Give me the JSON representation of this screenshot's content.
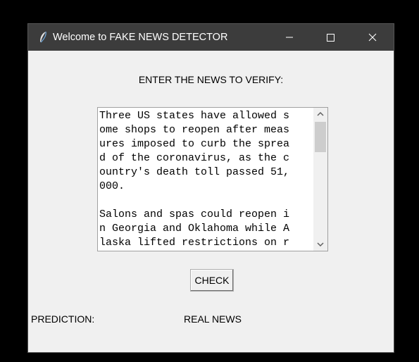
{
  "window": {
    "title": "Welcome to FAKE NEWS DETECTOR",
    "icon": "feather-icon",
    "controls": [
      "minimize-icon",
      "maximize-icon",
      "close-icon"
    ]
  },
  "form": {
    "prompt_label": "ENTER THE NEWS TO VERIFY:",
    "news_text": "Three US states have allowed some shops to reopen after measures imposed to curb the spread of the coronavirus, as the country's death toll passed 51,000.\n\nSalons and spas could reopen in Georgia and Oklahoma while Alaska lifted restrictions on r",
    "check_button_label": "CHECK",
    "prediction_label": "PREDICTION:",
    "prediction_value": "REAL NEWS"
  },
  "colors": {
    "titlebar": "#3c3c3c",
    "window_bg": "#f0f0f0",
    "textbox_bg": "#ffffff",
    "scroll_thumb": "#cdcdcd"
  }
}
